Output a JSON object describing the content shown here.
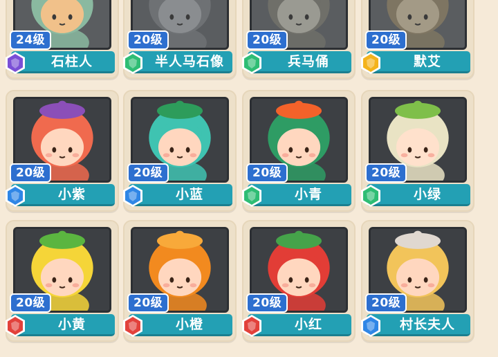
{
  "rarity_colors": {
    "purple": "#7a4fd6",
    "green": "#2ebd74",
    "gold": "#f4b31c",
    "blue": "#2f86e6",
    "red": "#e2413b"
  },
  "cards": [
    {
      "level": "24级",
      "name": "石柱人",
      "badge": "purple",
      "icon": "stone-pillar-character-icon",
      "skin": "#f1c18a",
      "hair": "#8ab9a0",
      "stone": true
    },
    {
      "level": "20级",
      "name": "半人马石像",
      "badge": "green",
      "icon": "centaur-statue-character-icon",
      "skin": "#8a8d90",
      "hair": "#6e7174",
      "stone": true
    },
    {
      "level": "20级",
      "name": "兵马俑",
      "badge": "green",
      "icon": "terracotta-warrior-character-icon",
      "skin": "#9a9a92",
      "hair": "#6f6f69",
      "stone": true
    },
    {
      "level": "20级",
      "name": "默艾",
      "badge": "gold",
      "icon": "moai-character-icon",
      "skin": "#a39a86",
      "hair": "#7e7562",
      "stone": true
    },
    {
      "level": "20级",
      "name": "小紫",
      "badge": "blue",
      "icon": "grape-girl-character-icon",
      "skin": "#ffd7bf",
      "hair": "#f06a4e",
      "hat": "#8b4fb8"
    },
    {
      "level": "20级",
      "name": "小蓝",
      "badge": "blue",
      "icon": "blue-boy-character-icon",
      "skin": "#ffd7bf",
      "hair": "#3fc3b1",
      "hat": "#2d9c5b"
    },
    {
      "level": "20级",
      "name": "小青",
      "badge": "green",
      "icon": "sushi-girl-character-icon",
      "skin": "#ffd7bf",
      "hair": "#2e9c64",
      "hat": "#f4622a"
    },
    {
      "level": "20级",
      "name": "小绿",
      "badge": "green",
      "icon": "matcha-girl-character-icon",
      "skin": "#ffe1cc",
      "hair": "#e9e3c4",
      "hat": "#7fbf4a"
    },
    {
      "level": "20级",
      "name": "小黄",
      "badge": "red",
      "icon": "lemon-girl-character-icon",
      "skin": "#ffd7bf",
      "hair": "#f5d538",
      "hat": "#5bb540"
    },
    {
      "level": "20级",
      "name": "小橙",
      "badge": "red",
      "icon": "orange-boy-character-icon",
      "skin": "#ffd7bf",
      "hair": "#f28a1f",
      "hat": "#f8a93a"
    },
    {
      "level": "20级",
      "name": "小红",
      "badge": "red",
      "icon": "strawberry-girl-character-icon",
      "skin": "#ffd7bf",
      "hair": "#e23d36",
      "hat": "#45a34a"
    },
    {
      "level": "20级",
      "name": "村长夫人",
      "badge": "blue",
      "icon": "chief-wife-character-icon",
      "skin": "#ffd7bf",
      "hair": "#f2c45a",
      "hat": "#e0d8d0"
    }
  ]
}
